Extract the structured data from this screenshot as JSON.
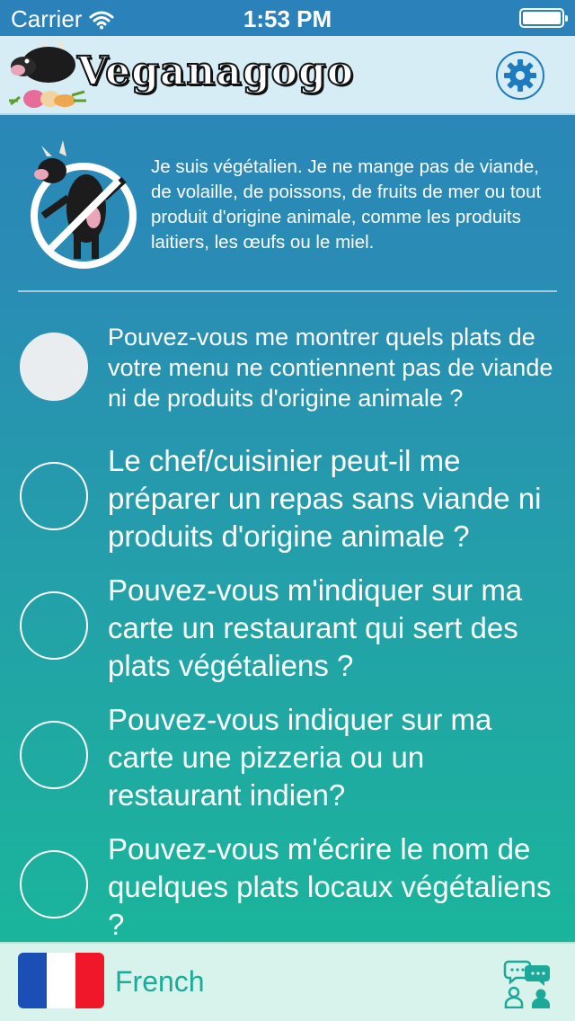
{
  "status": {
    "carrier": "Carrier",
    "time": "1:53 PM"
  },
  "header": {
    "app_name": "Veganagogo",
    "settings_icon": "gear-icon"
  },
  "intro": {
    "text": "Je suis végétalien. Je ne mange pas de viande, de volaille, de poissons, de fruits de mer ou tout produit d'origine animale, comme les produits laitiers, les œufs ou le miel."
  },
  "questions": [
    {
      "text": "Pouvez-vous me montrer quels plats de votre menu ne contiennent pas de viande ni de produits d'origine animale ?",
      "selected": true
    },
    {
      "text": "Le chef/cuisinier peut-il me préparer un repas sans viande ni produits d'origine animale ?",
      "selected": false
    },
    {
      "text": "Pouvez-vous m'indiquer sur ma carte un restaurant qui sert des plats végétaliens ?",
      "selected": false
    },
    {
      "text": "Pouvez-vous indiquer sur ma carte une pizzeria ou un restaurant indien?",
      "selected": false
    },
    {
      "text": "Pouvez-vous m'écrire le nom de quelques plats locaux végétaliens ?",
      "selected": false
    }
  ],
  "footer": {
    "language": "French",
    "flag_colors": [
      "#1b4fb5",
      "#ffffff",
      "#f1172b"
    ],
    "chat_icon": "chat-people-icon"
  },
  "colors": {
    "accent": "#1f7bbf",
    "footer_text": "#1cab98"
  }
}
